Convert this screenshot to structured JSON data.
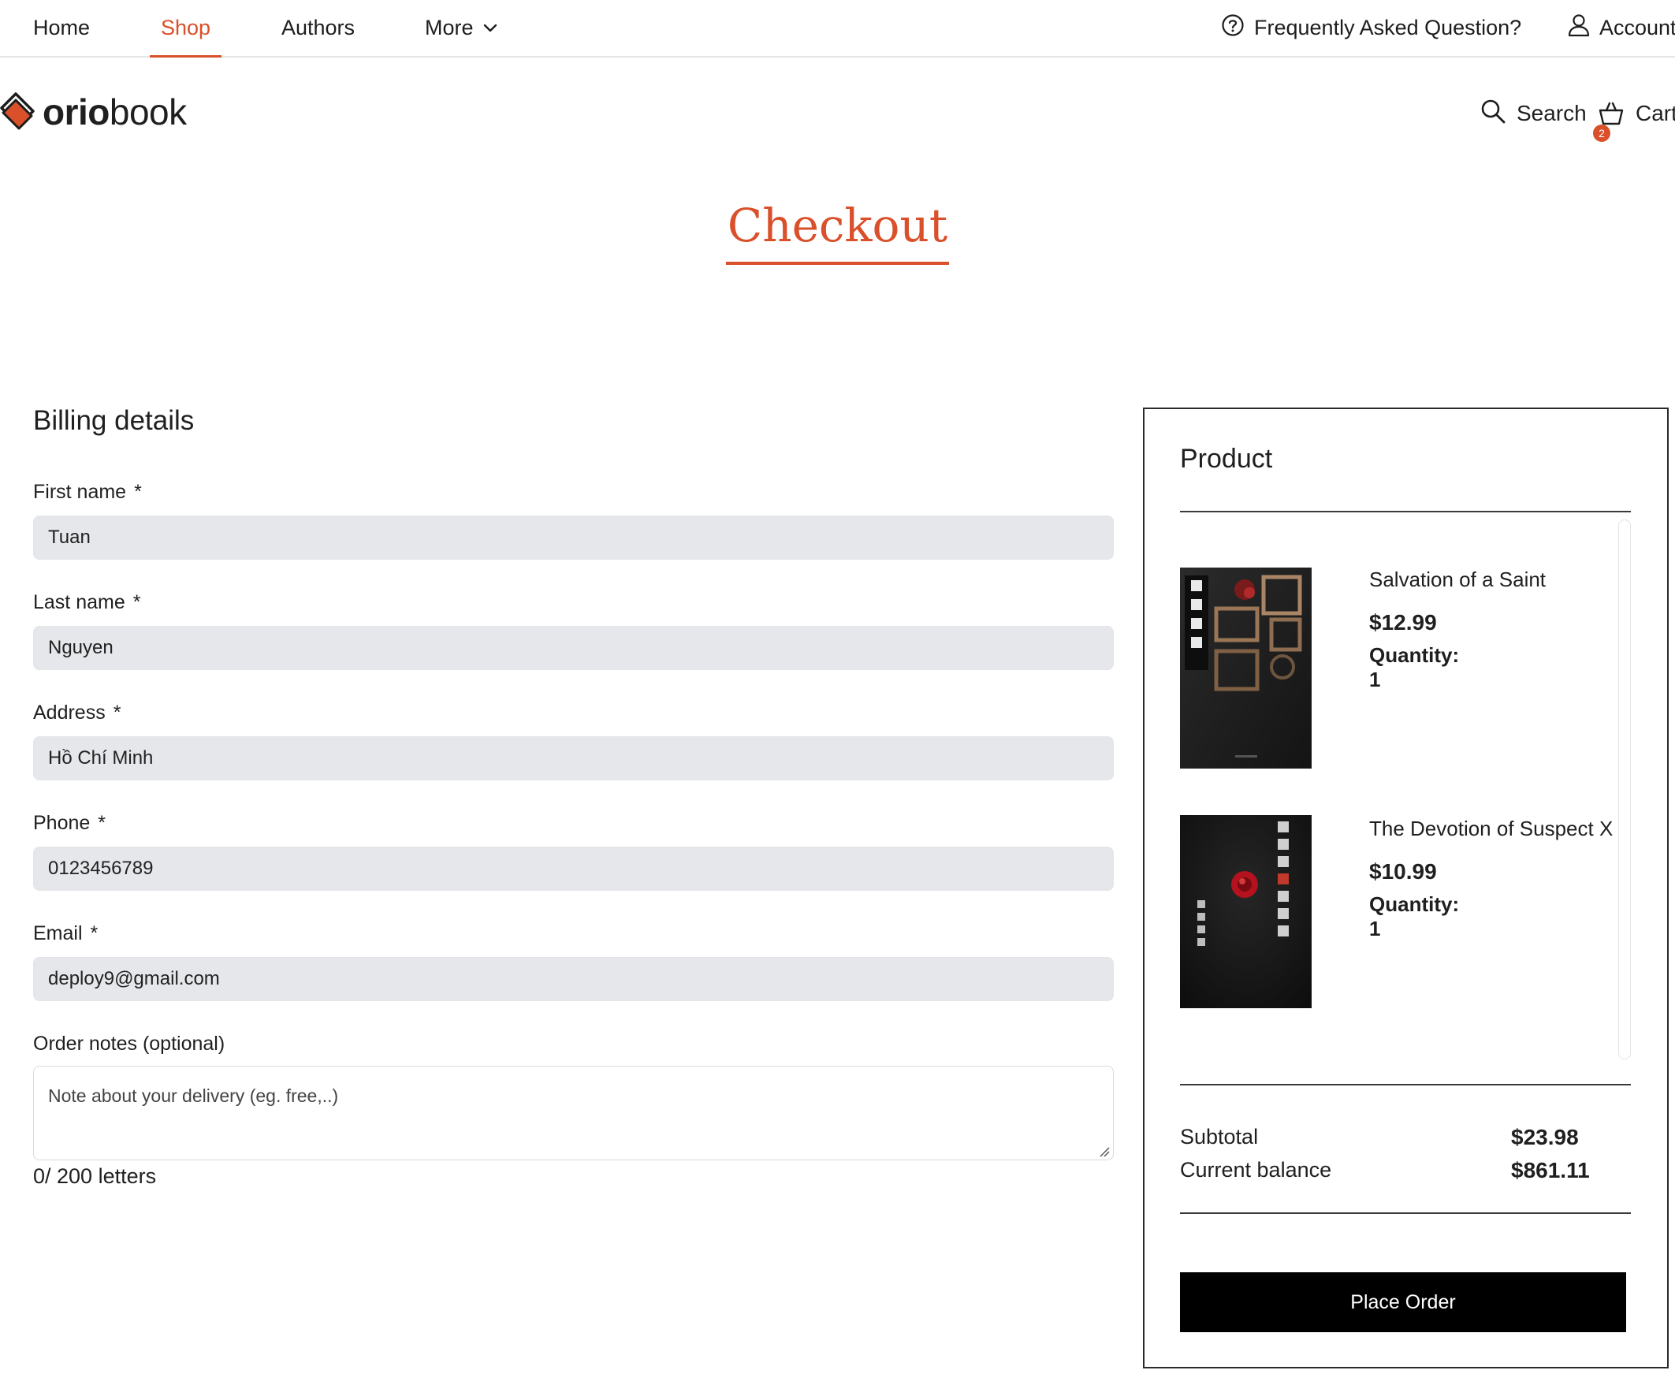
{
  "nav": {
    "items": [
      "Home",
      "Shop",
      "Authors",
      "More"
    ],
    "faq_label": "Frequently Asked Question?",
    "account_label": "Account"
  },
  "header": {
    "logo_bold": "orio",
    "logo_light": "book",
    "search_label": "Search",
    "cart_label": "Cart",
    "cart_count": "2"
  },
  "page": {
    "title": "Checkout"
  },
  "billing": {
    "heading": "Billing details",
    "required_mark": "*",
    "fields": [
      {
        "label": "First name",
        "value": "Tuan"
      },
      {
        "label": "Last name",
        "value": "Nguyen"
      },
      {
        "label": "Address",
        "value": "Hồ Chí Minh"
      },
      {
        "label": "Phone",
        "value": "0123456789"
      },
      {
        "label": "Email",
        "value": "deploy9@gmail.com"
      }
    ],
    "notes_label": "Order notes (optional)",
    "notes_placeholder": "Note about your delivery (eg. free,..)",
    "char_count": "0/ 200 letters"
  },
  "summary": {
    "heading": "Product",
    "quantity_label": "Quantity:",
    "products": [
      {
        "name": "Salvation of a Saint",
        "price": "$12.99",
        "quantity": "1"
      },
      {
        "name": "The Devotion of Suspect X",
        "price": "$10.99",
        "quantity": "1"
      }
    ],
    "subtotal_label": "Subtotal",
    "subtotal_value": "$23.98",
    "balance_label": "Current balance",
    "balance_value": "$861.11",
    "place_order_label": "Place Order"
  },
  "colors": {
    "accent": "#d9502a",
    "input_bg": "#e5e7eb",
    "button_bg": "#000000"
  }
}
